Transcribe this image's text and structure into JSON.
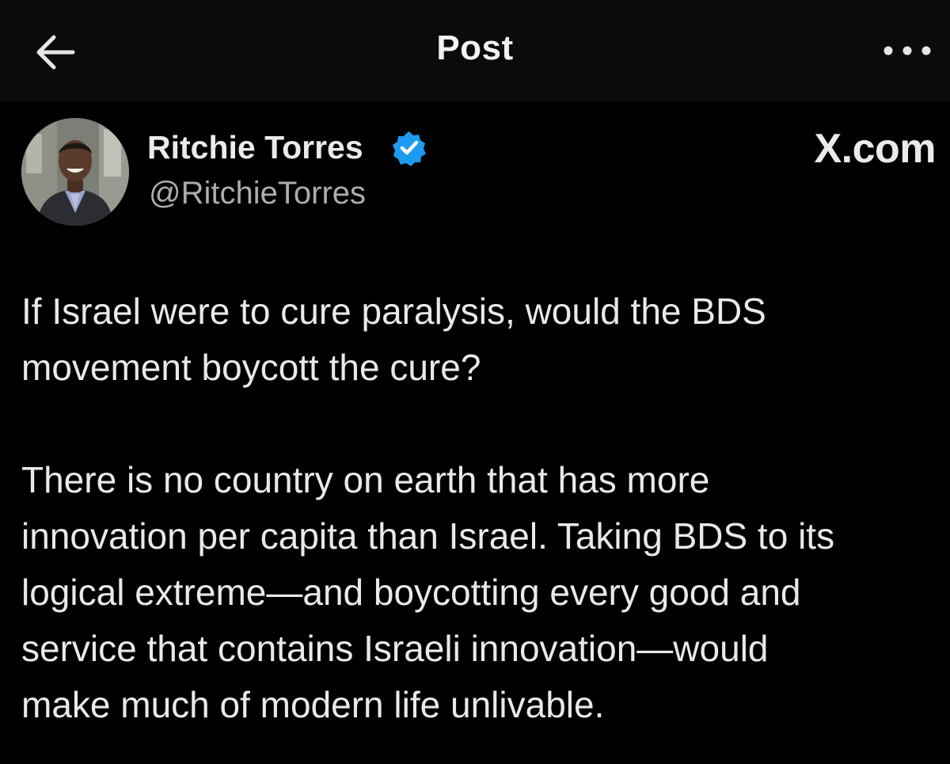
{
  "header": {
    "title": "Post",
    "back_icon": "arrow-left-icon",
    "more_icon": "more-horizontal-icon"
  },
  "author": {
    "name": "Ritchie Torres",
    "handle": "@RitchieTorres",
    "verified": true,
    "verified_color": "#1d9bf0",
    "avatar_icon": "profile-photo"
  },
  "source": {
    "label": "X.com"
  },
  "post": {
    "paragraphs": [
      {
        "lines": [
          "If Israel were to cure paralysis, would the BDS",
          "movement boycott the cure?"
        ]
      },
      {
        "lines": [
          "There is no country on earth that has more",
          "innovation per capita than Israel.  Taking BDS to its",
          "logical extreme—and boycotting every good and",
          "service that contains Israeli innovation—would",
          "make much of modern life unlivable."
        ]
      }
    ]
  },
  "colors": {
    "background": "#000000",
    "header_background": "#0b0b0b",
    "text_primary": "#e7e9ea",
    "text_secondary": "#a9adb1"
  }
}
